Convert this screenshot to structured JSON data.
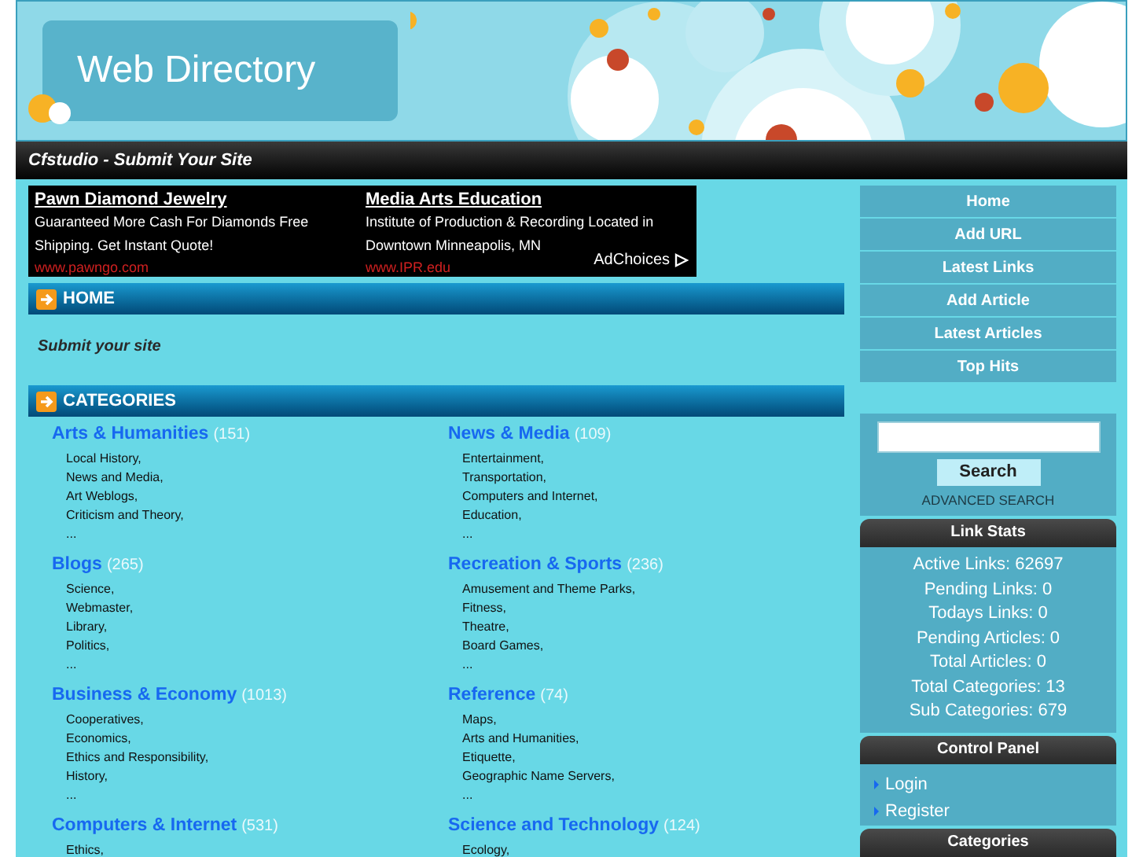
{
  "header": {
    "logo": "Web Directory"
  },
  "title_bar": "Cfstudio - Submit Your Site",
  "ads": [
    {
      "title": "Pawn Diamond Jewelry",
      "text": "Guaranteed More Cash For Diamonds Free Shipping. Get Instant Quote!",
      "url": "www.pawngo.com"
    },
    {
      "title": "Media Arts Education",
      "text": "Institute of Production & Recording Located in Downtown Minneapolis, MN",
      "url": "www.IPR.edu"
    }
  ],
  "ad_choices": "AdChoices",
  "home": {
    "heading": "HOME",
    "text": "Submit your site"
  },
  "categories": {
    "heading": "CATEGORIES",
    "items": [
      {
        "name": "Arts & Humanities",
        "count": "(151)",
        "subs": [
          "Local History,",
          "News and Media,",
          "Art Weblogs,",
          "Criticism and Theory,",
          "..."
        ]
      },
      {
        "name": "News & Media",
        "count": "(109)",
        "subs": [
          "Entertainment,",
          "Transportation,",
          "Computers and Internet,",
          "Education,",
          "..."
        ]
      },
      {
        "name": "Blogs",
        "count": "(265)",
        "subs": [
          "Science,",
          "Webmaster,",
          "Library,",
          "Politics,",
          "..."
        ]
      },
      {
        "name": "Recreation & Sports",
        "count": "(236)",
        "subs": [
          "Amusement and Theme Parks,",
          "Fitness,",
          "Theatre,",
          "Board Games,",
          "..."
        ]
      },
      {
        "name": "Business & Economy",
        "count": "(1013)",
        "subs": [
          "Cooperatives,",
          "Economics,",
          "Ethics and Responsibility,",
          "History,",
          "..."
        ]
      },
      {
        "name": "Reference",
        "count": "(74)",
        "subs": [
          "Maps,",
          "Arts and Humanities,",
          "Etiquette,",
          "Geographic Name Servers,",
          "..."
        ]
      },
      {
        "name": "Computers & Internet",
        "count": "(531)",
        "subs": [
          "Ethics,"
        ]
      },
      {
        "name": "Science and Technology",
        "count": "(124)",
        "subs": [
          "Ecology,"
        ]
      }
    ]
  },
  "nav": [
    "Home",
    "Add URL",
    "Latest Links",
    "Add Article",
    "Latest Articles",
    "Top Hits"
  ],
  "search": {
    "button": "Search",
    "advanced": "ADVANCED SEARCH"
  },
  "link_stats": {
    "heading": "Link Stats",
    "lines": [
      "Active Links: 62697",
      "Pending Links: 0",
      "Todays Links: 0",
      "Pending Articles: 0",
      "Total Articles: 0",
      "Total Categories: 13",
      "Sub Categories: 679"
    ]
  },
  "control_panel": {
    "heading": "Control Panel",
    "links": [
      "Login",
      "Register"
    ]
  },
  "categories_panel": {
    "heading": "Categories"
  }
}
